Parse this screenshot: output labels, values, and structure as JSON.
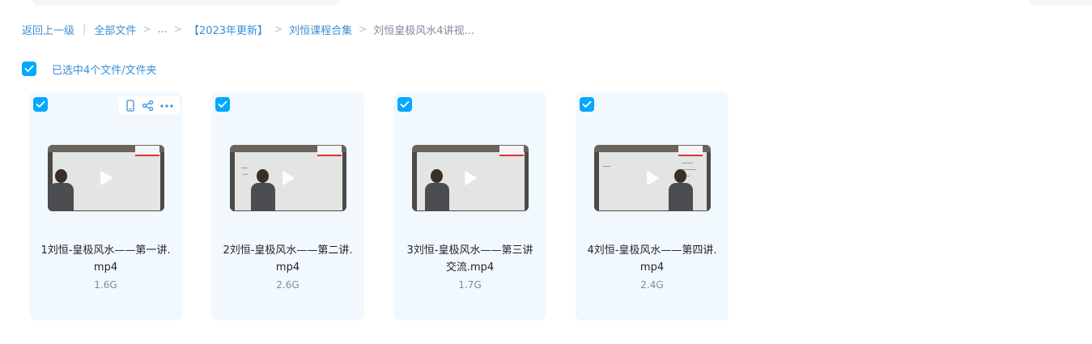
{
  "breadcrumb": {
    "back": "返回上一级",
    "separator_bar": "|",
    "root": "全部文件",
    "ellipsis": "...",
    "level1": "【2023年更新】",
    "level2": "刘恒课程合集",
    "current": "刘恒皇极风水4讲视...",
    "arrow": ">"
  },
  "selection": {
    "label": "已选中4个文件/文件夹",
    "checked": true
  },
  "files": [
    {
      "name": "1刘恒-皇极风水——第一讲.mp4",
      "size": "1.6G",
      "selected": true
    },
    {
      "name": "2刘恒-皇极风水——第二讲.mp4",
      "size": "2.6G",
      "selected": true
    },
    {
      "name": "3刘恒-皇极风水——第三讲交流.mp4",
      "size": "1.7G",
      "selected": true
    },
    {
      "name": "4刘恒-皇极风水——第四讲.mp4",
      "size": "2.4G",
      "selected": true
    }
  ],
  "card_actions": [
    "phone-icon",
    "share-icon",
    "more-icon"
  ],
  "colors": {
    "accent": "#06a7ff",
    "link": "#3a8fd8",
    "card_bg": "#f2f9fe",
    "muted": "#818999"
  }
}
